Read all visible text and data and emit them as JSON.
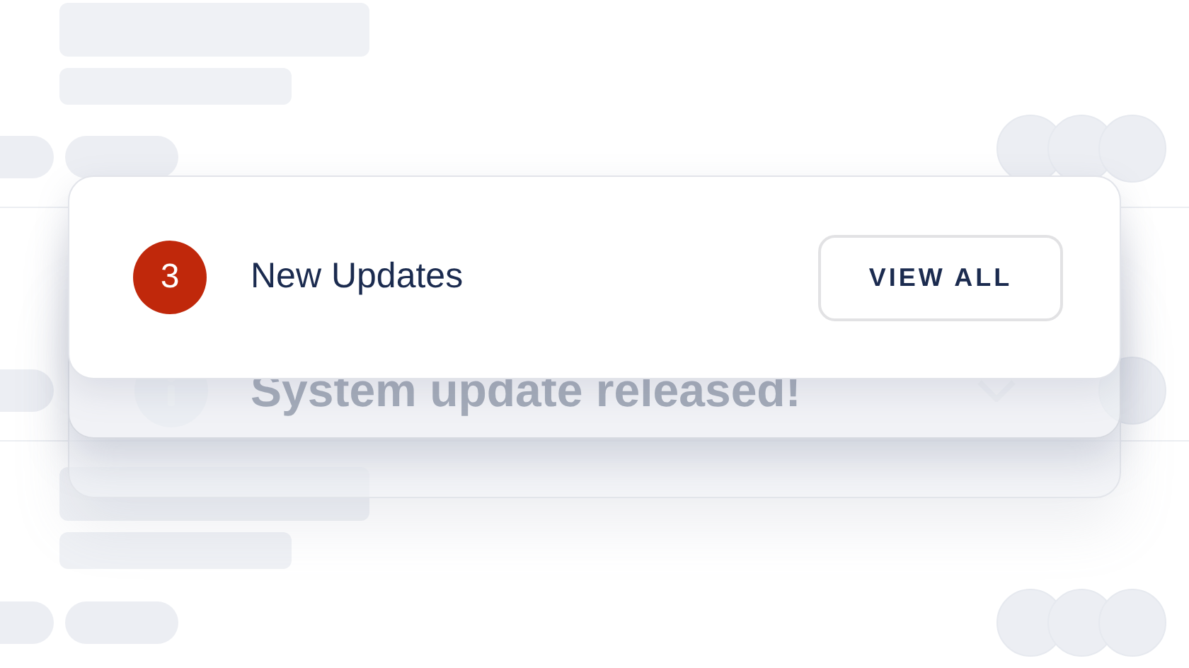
{
  "background_item": {
    "title": "System update released!"
  },
  "notification": {
    "count": "3",
    "title": "New Updates",
    "action": "VIEW ALL"
  }
}
